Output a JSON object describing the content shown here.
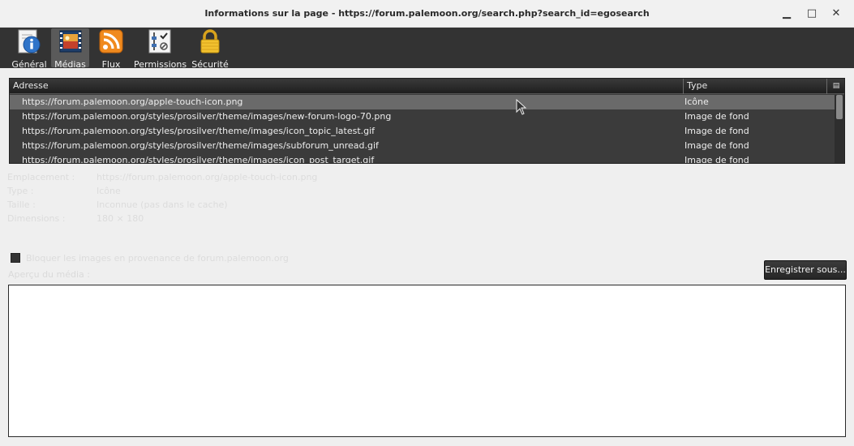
{
  "window": {
    "title": "Informations sur la page - https://forum.palemoon.org/search.php?search_id=egosearch",
    "minimize_glyph": "▁",
    "maximize_glyph": "□",
    "close_glyph": "✕"
  },
  "toolbar": {
    "items": [
      {
        "label": "Général",
        "icon": "info-icon"
      },
      {
        "label": "Médias",
        "icon": "media-icon",
        "active": true
      },
      {
        "label": "Flux",
        "icon": "rss-icon"
      },
      {
        "label": "Permissions",
        "icon": "permissions-icon"
      },
      {
        "label": "Sécurité",
        "icon": "lock-icon"
      }
    ]
  },
  "media_list": {
    "columns": [
      "Adresse",
      "Type"
    ],
    "rows": [
      {
        "address": "https://forum.palemoon.org/apple-touch-icon.png",
        "type": "Icône"
      },
      {
        "address": "https://forum.palemoon.org/styles/prosilver/theme/images/new-forum-logo-70.png",
        "type": "Image de fond"
      },
      {
        "address": "https://forum.palemoon.org/styles/prosilver/theme/images/icon_topic_latest.gif",
        "type": "Image de fond"
      },
      {
        "address": "https://forum.palemoon.org/styles/prosilver/theme/images/subforum_unread.gif",
        "type": "Image de fond"
      },
      {
        "address": "https://forum.palemoon.org/styles/prosilver/theme/images/icon_post_target.gif",
        "type": "Image de fond"
      }
    ]
  },
  "details": {
    "location_label": "Emplacement :",
    "location_value": "https://forum.palemoon.org/apple-touch-icon.png",
    "type_label": "Type :",
    "type_value": "Icône",
    "size_label": "Taille :",
    "size_value": "Inconnue (pas dans le cache)",
    "dimensions_label": "Dimensions :",
    "dimensions_value": "180 × 180"
  },
  "block_images": {
    "label": "Bloquer les images en provenance de forum.palemoon.org"
  },
  "preview": {
    "label": "Aperçu du média :",
    "save_button": "Enregistrer sous..."
  },
  "colors": {
    "toolbar_bg": "#333333",
    "list_bg": "#3b3b3b",
    "selected_row": "#6a6a6a",
    "window_bg": "#efefef"
  }
}
